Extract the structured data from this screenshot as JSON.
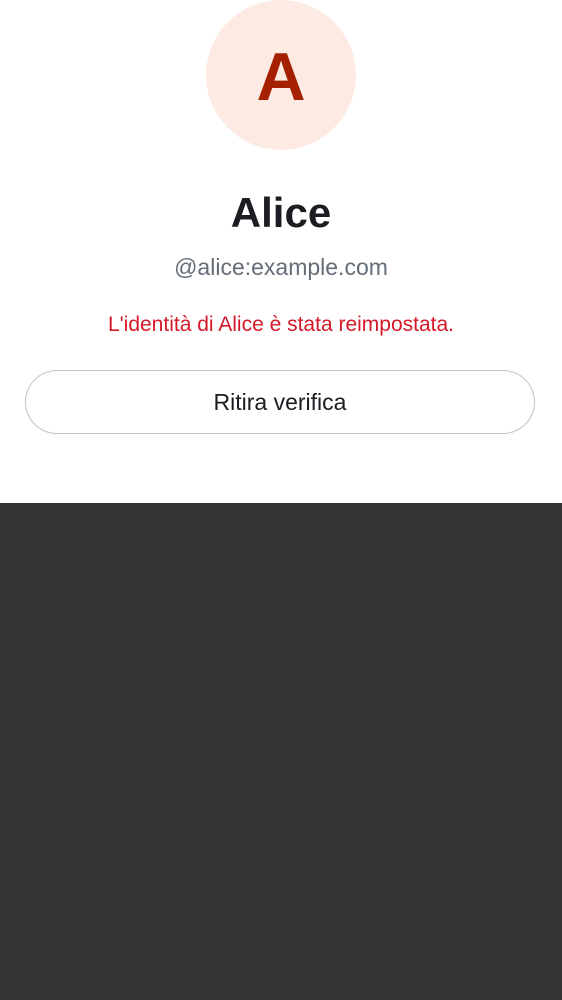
{
  "profile": {
    "avatar_letter": "A",
    "display_name": "Alice",
    "user_id": "@alice:example.com",
    "warning": "L'identità di Alice è stata reimpostata."
  },
  "actions": {
    "withdraw_verification_label": "Ritira verifica"
  },
  "colors": {
    "avatar_background": "#fdebe3",
    "avatar_letter": "#a52000",
    "warning_text": "#d51928",
    "backdrop": "#333333"
  }
}
